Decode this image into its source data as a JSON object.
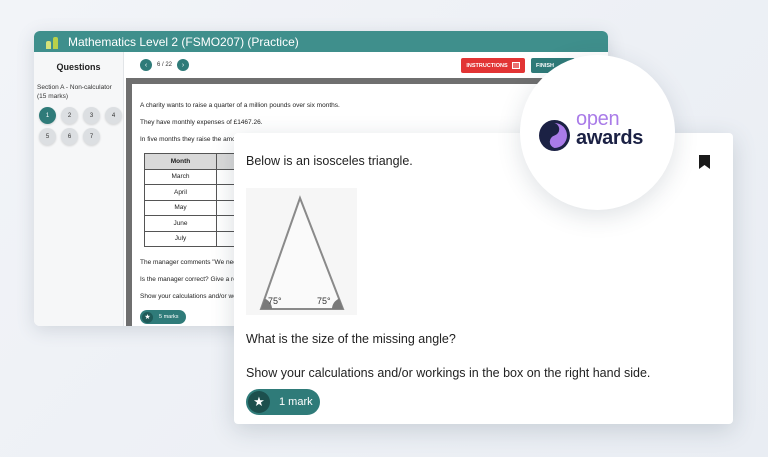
{
  "window": {
    "title": "Mathematics Level 2 (FSMO207) (Practice)"
  },
  "sidebar": {
    "title": "Questions",
    "section_label": "Section A - Non-calculator (15 marks)",
    "questions": [
      "1",
      "2",
      "3",
      "4",
      "5",
      "6",
      "7"
    ],
    "active_question": "1"
  },
  "toolbar": {
    "page_indicator": "6 / 22",
    "prev_icon": "chevron-left-icon",
    "next_icon": "chevron-right-icon",
    "instructions_label": "INSTRUCTIONS",
    "finish_label": "FINISH"
  },
  "question_doc": {
    "line1": "A charity wants to raise a quarter of a million pounds over six months.",
    "line2": "They have monthly expenses of £1467.26.",
    "line3": "In five months they raise the amo",
    "table_header": "Month",
    "months": [
      "March",
      "April",
      "May",
      "June",
      "July"
    ],
    "line4": "The manager comments \"We need",
    "line5": "Is the manager correct?  Give a re",
    "line6": "Show your calculations and/or wo",
    "marks_label": "5 marks"
  },
  "card": {
    "question": "Below is an isosceles triangle.",
    "angle_left": "75°",
    "angle_right": "75°",
    "prompt": "What is the size of the missing angle?",
    "instruction": "Show your calculations and/or workings in the box on the right hand side.",
    "mark_label": "1 mark"
  },
  "brand": {
    "word1": "open",
    "word2": "awards"
  },
  "colors": {
    "teal": "#2f7b79",
    "title_bar": "#3f8f8c",
    "instructions_red": "#e23434",
    "brand_purple": "#a97be8",
    "brand_navy": "#1b2144"
  }
}
